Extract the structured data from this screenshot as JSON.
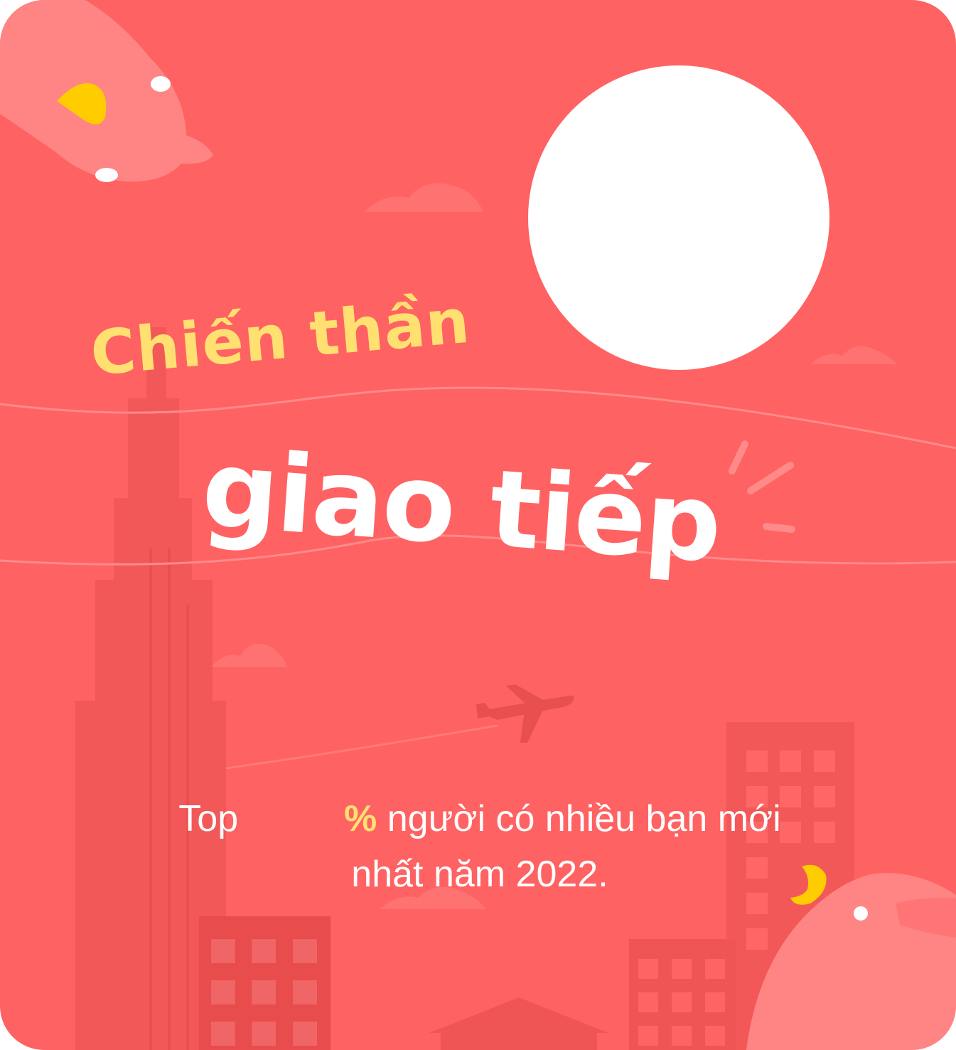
{
  "card": {
    "title_line_1": "Chiến thần",
    "title_line_2": "giao tiếp",
    "stat_prefix": "Top",
    "stat_percent_value": "",
    "stat_percent_sign": "%",
    "stat_text_1": "người có nhiều bạn mới",
    "stat_text_2": "nhất năm 2022."
  },
  "colors": {
    "background": "#FF6262",
    "accent_yellow": "#FFE071",
    "building_dark": "#F05555",
    "mascot_pink": "#FF8585",
    "beak_yellow": "#FFCC00"
  },
  "icons": [
    "mascot-bird-top-left",
    "mascot-bird-bottom-right",
    "airplane-icon",
    "cloud-icon",
    "sparkle-icon"
  ]
}
